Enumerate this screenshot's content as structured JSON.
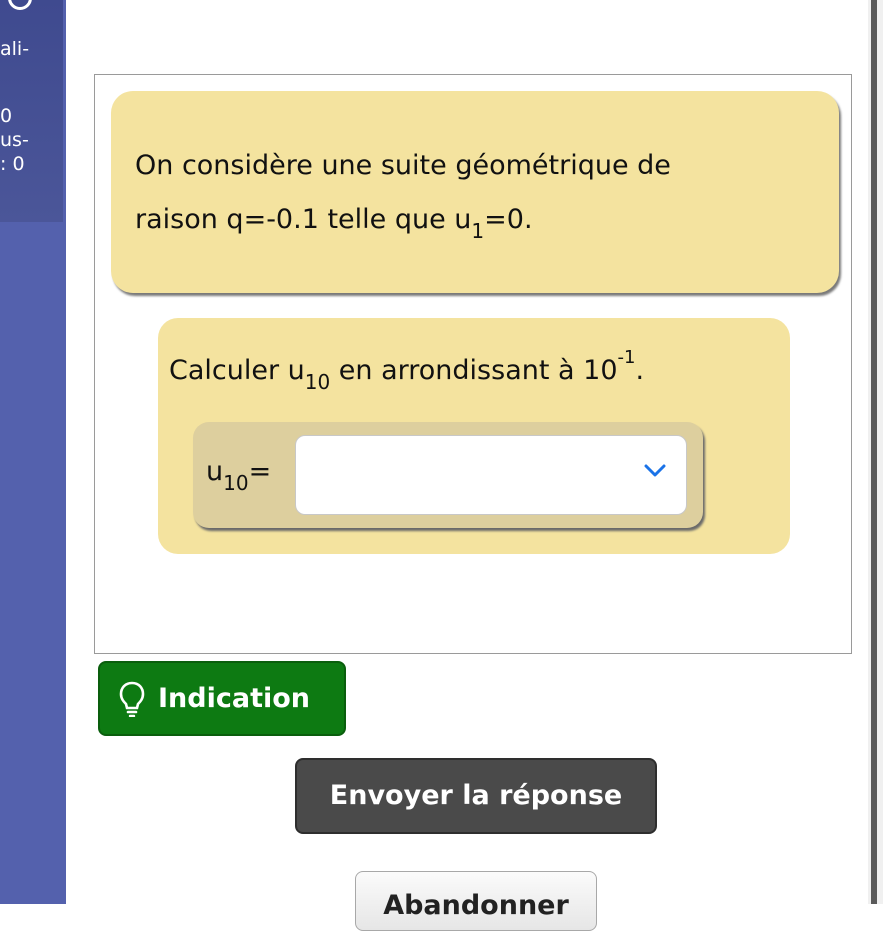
{
  "sidebar": {
    "lines": [
      "ali-",
      "0",
      "us-",
      ": 0"
    ]
  },
  "exercise": {
    "statement_line1": "On considère une suite géométrique de",
    "statement_line2_pre": "raison q=-0.1 telle que u",
    "statement_line2_sub": "1",
    "statement_line2_post": "=0.",
    "question_pre": "Calculer u",
    "question_sub": "10",
    "question_mid": " en arrondissant à 10",
    "question_sup": "-1",
    "question_post": ".",
    "answer_label_pre": "u",
    "answer_label_sub": "10",
    "answer_label_post": "=",
    "answer_value": ""
  },
  "buttons": {
    "hint": "Indication",
    "submit": "Envoyer la réponse",
    "third": "Abandonner"
  },
  "colors": {
    "sidebar": "#5461ad",
    "statement_bg": "#f4e39f",
    "answer_bg": "#ddcf9e",
    "hint_button": "#0d7a12",
    "submit_button": "#4a4a4a",
    "chevron": "#1a73e8"
  },
  "icons": {
    "hint": "lightbulb-icon",
    "select": "chevron-down-icon"
  }
}
